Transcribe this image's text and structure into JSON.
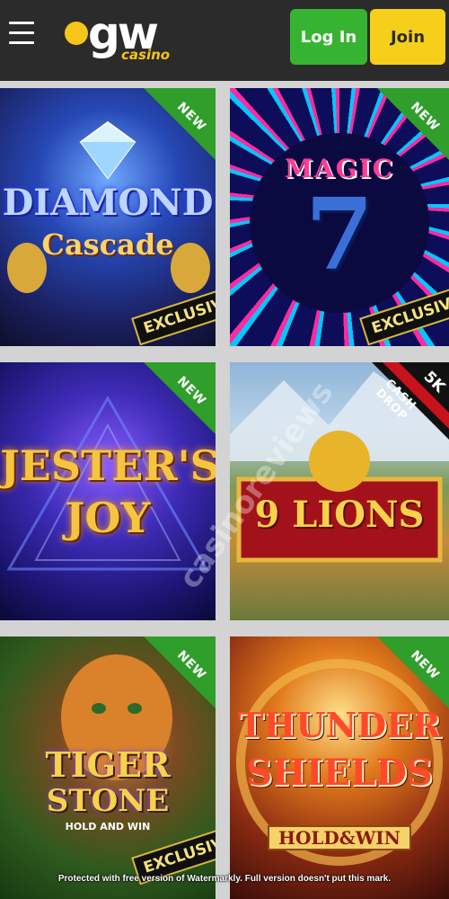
{
  "header": {
    "logo_main": "gw",
    "logo_sub": "casino",
    "login_label": "Log In",
    "join_label": "Join"
  },
  "games": [
    {
      "line1": "DIAMOND",
      "line2": "Cascade",
      "badge": "NEW",
      "exclusive": "EXCLUSIVE"
    },
    {
      "line1": "MAGIC",
      "line2": "7",
      "badge": "NEW",
      "exclusive": "EXCLUSIVE"
    },
    {
      "line1": "JESTER'S",
      "line2": "JOY",
      "badge": "NEW"
    },
    {
      "line1": "9 LIONS",
      "badge_top": "5K",
      "badge_bottom": "CASH DROP"
    },
    {
      "line1": "TIGER",
      "line2": "STONE",
      "line3": "HOLD AND WIN",
      "badge": "NEW",
      "exclusive": "EXCLUSIVE"
    },
    {
      "line1": "THUNDER",
      "line2": "SHIELDS",
      "line3": "HOLD&WIN",
      "badge": "NEW"
    }
  ],
  "watermark": {
    "diagonal": "casinoreviews",
    "footer": "Protected with free version of Watermarkly. Full version doesn't put this mark."
  },
  "colors": {
    "header_bg": "#2b2b2b",
    "login_bg": "#36b431",
    "join_bg": "#f6cf1a",
    "new_ribbon": "#2f9e2a"
  }
}
